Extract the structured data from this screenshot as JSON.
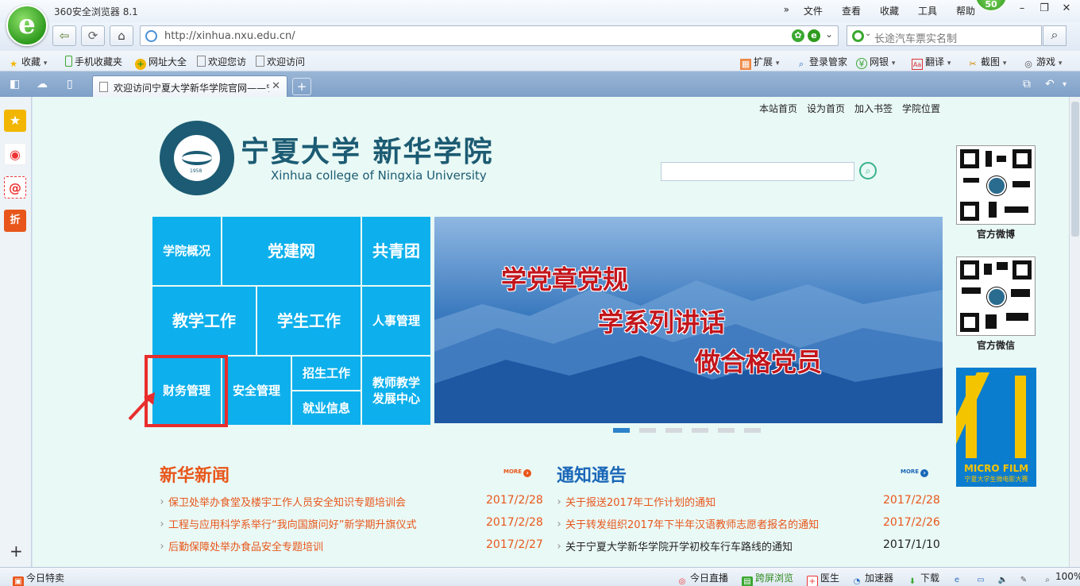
{
  "browser": {
    "app_title": "360安全浏览器 8.1",
    "menu": [
      "文件",
      "查看",
      "收藏",
      "工具",
      "帮助"
    ],
    "badge": "50",
    "url": "http://xinhua.nxu.edu.cn/",
    "search_placeholder": "长途汽车票实名制",
    "bookmarks_left": [
      "收藏",
      "手机收藏夹",
      "网址大全",
      "欢迎您访",
      "欢迎访问"
    ],
    "bookmarks_right": [
      "扩展",
      "登录管家",
      "网银",
      "翻译",
      "截图",
      "游戏"
    ],
    "tab_title": "欢迎访问宁夏大学新华学院官网——宁",
    "status": {
      "left": "今日特卖",
      "items": [
        "今日直播",
        "跨屏浏览",
        "医生",
        "加速器",
        "下载"
      ],
      "zoom": "100%"
    }
  },
  "site": {
    "top_links": [
      "本站首页",
      "设为首页",
      "加入书签",
      "学院位置"
    ],
    "name_cn": "宁夏大学 新华学院",
    "name_en": "Xinhua college of Ningxia University",
    "emblem_year": "1958",
    "tiles": {
      "t1": "学院概况",
      "t2": "党建网",
      "t3": "共青团",
      "t4": "教学工作",
      "t5": "学生工作",
      "t6": "人事管理",
      "t7": "财务管理",
      "t8": "安全管理",
      "t9": "招生工作",
      "t10": "就业信息",
      "t11a": "教师教学",
      "t11b": "发展中心"
    },
    "banner": {
      "line1": "学党章党规",
      "line2": "学系列讲话",
      "line3": "做合格党员"
    },
    "right": {
      "weibo_label": "官方微博",
      "weixin_label": "官方微信",
      "film_title": "MICRO FILM",
      "film_sub": "宁夏大学生微电影大赛"
    },
    "news": {
      "title": "新华新闻",
      "more": "MORE",
      "items": [
        {
          "text": "保卫处举办食堂及楼宇工作人员安全知识专题培训会",
          "date": "2017/2/28"
        },
        {
          "text": "工程与应用科学系举行“我向国旗问好”新学期升旗仪式",
          "date": "2017/2/28"
        },
        {
          "text": "后勤保障处举办食品安全专题培训",
          "date": "2017/2/27"
        }
      ]
    },
    "notices": {
      "title": "通知通告",
      "more": "MORE",
      "items": [
        {
          "text": "关于报送2017年工作计划的通知",
          "date": "2017/2/28",
          "highlight": true
        },
        {
          "text": "关于转发组织2017年下半年汉语教师志愿者报名的通知",
          "date": "2017/2/26",
          "highlight": true
        },
        {
          "text": "关于宁夏大学新华学院开学初校车行车路线的通知",
          "date": "2017/1/10",
          "highlight": false
        }
      ]
    }
  },
  "colors": {
    "tile": "#0db0ec",
    "accent_orange": "#e8561b",
    "accent_blue": "#1a67b8",
    "highlight_red": "#e82d2d",
    "page_bg": "#e9f9f5"
  }
}
